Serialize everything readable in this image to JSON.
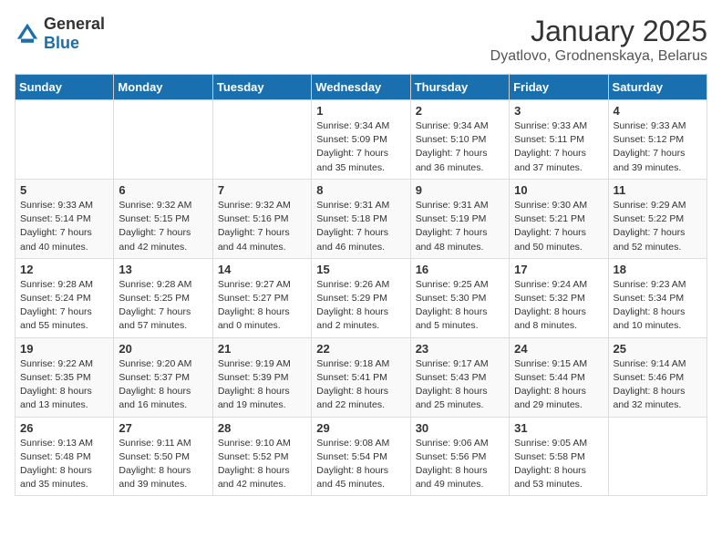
{
  "header": {
    "logo_general": "General",
    "logo_blue": "Blue",
    "title": "January 2025",
    "subtitle": "Dyatlovo, Grodnenskaya, Belarus"
  },
  "weekdays": [
    "Sunday",
    "Monday",
    "Tuesday",
    "Wednesday",
    "Thursday",
    "Friday",
    "Saturday"
  ],
  "weeks": [
    [
      {
        "day": "",
        "info": ""
      },
      {
        "day": "",
        "info": ""
      },
      {
        "day": "",
        "info": ""
      },
      {
        "day": "1",
        "info": "Sunrise: 9:34 AM\nSunset: 5:09 PM\nDaylight: 7 hours and 35 minutes."
      },
      {
        "day": "2",
        "info": "Sunrise: 9:34 AM\nSunset: 5:10 PM\nDaylight: 7 hours and 36 minutes."
      },
      {
        "day": "3",
        "info": "Sunrise: 9:33 AM\nSunset: 5:11 PM\nDaylight: 7 hours and 37 minutes."
      },
      {
        "day": "4",
        "info": "Sunrise: 9:33 AM\nSunset: 5:12 PM\nDaylight: 7 hours and 39 minutes."
      }
    ],
    [
      {
        "day": "5",
        "info": "Sunrise: 9:33 AM\nSunset: 5:14 PM\nDaylight: 7 hours and 40 minutes."
      },
      {
        "day": "6",
        "info": "Sunrise: 9:32 AM\nSunset: 5:15 PM\nDaylight: 7 hours and 42 minutes."
      },
      {
        "day": "7",
        "info": "Sunrise: 9:32 AM\nSunset: 5:16 PM\nDaylight: 7 hours and 44 minutes."
      },
      {
        "day": "8",
        "info": "Sunrise: 9:31 AM\nSunset: 5:18 PM\nDaylight: 7 hours and 46 minutes."
      },
      {
        "day": "9",
        "info": "Sunrise: 9:31 AM\nSunset: 5:19 PM\nDaylight: 7 hours and 48 minutes."
      },
      {
        "day": "10",
        "info": "Sunrise: 9:30 AM\nSunset: 5:21 PM\nDaylight: 7 hours and 50 minutes."
      },
      {
        "day": "11",
        "info": "Sunrise: 9:29 AM\nSunset: 5:22 PM\nDaylight: 7 hours and 52 minutes."
      }
    ],
    [
      {
        "day": "12",
        "info": "Sunrise: 9:28 AM\nSunset: 5:24 PM\nDaylight: 7 hours and 55 minutes."
      },
      {
        "day": "13",
        "info": "Sunrise: 9:28 AM\nSunset: 5:25 PM\nDaylight: 7 hours and 57 minutes."
      },
      {
        "day": "14",
        "info": "Sunrise: 9:27 AM\nSunset: 5:27 PM\nDaylight: 8 hours and 0 minutes."
      },
      {
        "day": "15",
        "info": "Sunrise: 9:26 AM\nSunset: 5:29 PM\nDaylight: 8 hours and 2 minutes."
      },
      {
        "day": "16",
        "info": "Sunrise: 9:25 AM\nSunset: 5:30 PM\nDaylight: 8 hours and 5 minutes."
      },
      {
        "day": "17",
        "info": "Sunrise: 9:24 AM\nSunset: 5:32 PM\nDaylight: 8 hours and 8 minutes."
      },
      {
        "day": "18",
        "info": "Sunrise: 9:23 AM\nSunset: 5:34 PM\nDaylight: 8 hours and 10 minutes."
      }
    ],
    [
      {
        "day": "19",
        "info": "Sunrise: 9:22 AM\nSunset: 5:35 PM\nDaylight: 8 hours and 13 minutes."
      },
      {
        "day": "20",
        "info": "Sunrise: 9:20 AM\nSunset: 5:37 PM\nDaylight: 8 hours and 16 minutes."
      },
      {
        "day": "21",
        "info": "Sunrise: 9:19 AM\nSunset: 5:39 PM\nDaylight: 8 hours and 19 minutes."
      },
      {
        "day": "22",
        "info": "Sunrise: 9:18 AM\nSunset: 5:41 PM\nDaylight: 8 hours and 22 minutes."
      },
      {
        "day": "23",
        "info": "Sunrise: 9:17 AM\nSunset: 5:43 PM\nDaylight: 8 hours and 25 minutes."
      },
      {
        "day": "24",
        "info": "Sunrise: 9:15 AM\nSunset: 5:44 PM\nDaylight: 8 hours and 29 minutes."
      },
      {
        "day": "25",
        "info": "Sunrise: 9:14 AM\nSunset: 5:46 PM\nDaylight: 8 hours and 32 minutes."
      }
    ],
    [
      {
        "day": "26",
        "info": "Sunrise: 9:13 AM\nSunset: 5:48 PM\nDaylight: 8 hours and 35 minutes."
      },
      {
        "day": "27",
        "info": "Sunrise: 9:11 AM\nSunset: 5:50 PM\nDaylight: 8 hours and 39 minutes."
      },
      {
        "day": "28",
        "info": "Sunrise: 9:10 AM\nSunset: 5:52 PM\nDaylight: 8 hours and 42 minutes."
      },
      {
        "day": "29",
        "info": "Sunrise: 9:08 AM\nSunset: 5:54 PM\nDaylight: 8 hours and 45 minutes."
      },
      {
        "day": "30",
        "info": "Sunrise: 9:06 AM\nSunset: 5:56 PM\nDaylight: 8 hours and 49 minutes."
      },
      {
        "day": "31",
        "info": "Sunrise: 9:05 AM\nSunset: 5:58 PM\nDaylight: 8 hours and 53 minutes."
      },
      {
        "day": "",
        "info": ""
      }
    ]
  ]
}
